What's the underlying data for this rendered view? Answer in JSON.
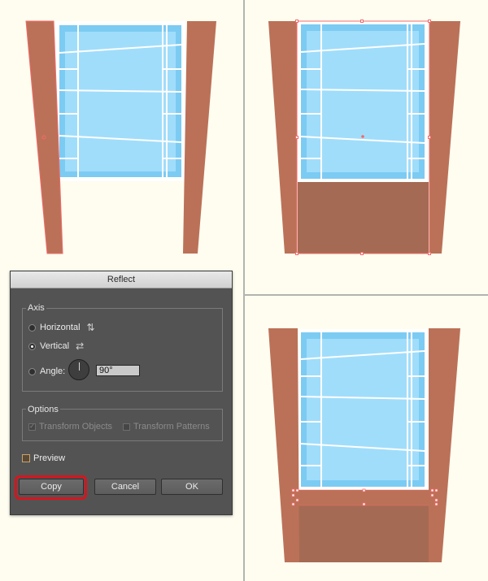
{
  "dialog": {
    "title": "Reflect",
    "axis": {
      "legend": "Axis",
      "horizontal_label": "Horizontal",
      "vertical_label": "Vertical",
      "angle_label": "Angle:",
      "angle_value": "90°",
      "selected": "Vertical"
    },
    "options": {
      "legend": "Options",
      "transform_objects_label": "Transform Objects",
      "transform_objects_checked": true,
      "transform_patterns_label": "Transform Patterns",
      "transform_patterns_checked": false
    },
    "preview_label": "Preview",
    "preview_checked": false,
    "buttons": {
      "copy": "Copy",
      "cancel": "Cancel",
      "ok": "OK"
    },
    "highlighted_button": "Copy"
  },
  "colors": {
    "background": "#fefdf0",
    "wood": "#bb7158",
    "wood_dark": "#a56a53",
    "glass_light": "#a0ddfb",
    "glass_mid": "#7ccbf3",
    "selection": "#f26a6a",
    "highlight": "#d6151e"
  }
}
